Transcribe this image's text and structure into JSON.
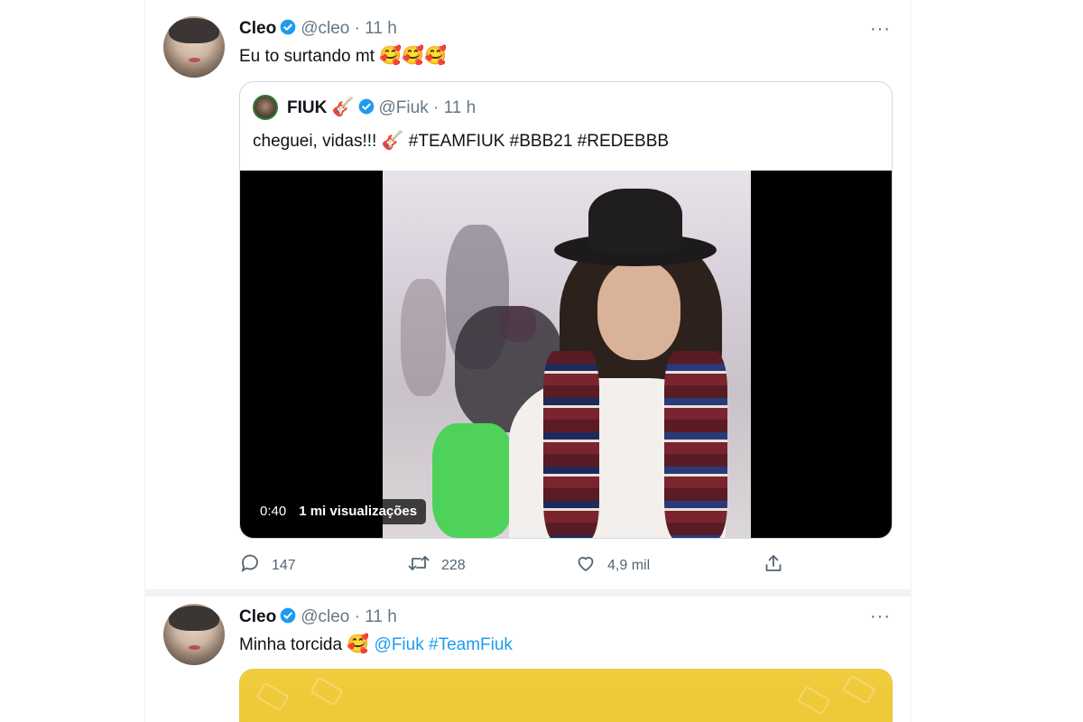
{
  "colors": {
    "accent": "#1d9bf0",
    "verified": "#1d9bf0",
    "text": "#0f1419",
    "muted": "#657786"
  },
  "tweet1": {
    "name": "Cleo",
    "handle": "@cleo",
    "dot": "·",
    "time": "11 h",
    "more_icon": "···",
    "text": "Eu to surtando mt",
    "emoji": "🥰🥰🥰",
    "quote": {
      "name": "FIUK",
      "name_emoji": "🎸",
      "handle": "@Fiuk",
      "dot": "·",
      "time": "11 h",
      "text": "cheguei, vidas!!!",
      "text_emoji": "🎸",
      "hashtags": "#TEAMFIUK #BBB21 #REDEBBB",
      "video": {
        "duration": "0:40",
        "views": "1 mi visualizações"
      }
    },
    "actions": {
      "replies": "147",
      "retweets": "228",
      "likes": "4,9 mil"
    }
  },
  "tweet2": {
    "name": "Cleo",
    "handle": "@cleo",
    "dot": "·",
    "time": "11 h",
    "more_icon": "···",
    "text": "Minha torcida",
    "emoji": "🥰",
    "mention": "@Fiuk",
    "hashtag": "#TeamFiuk"
  }
}
